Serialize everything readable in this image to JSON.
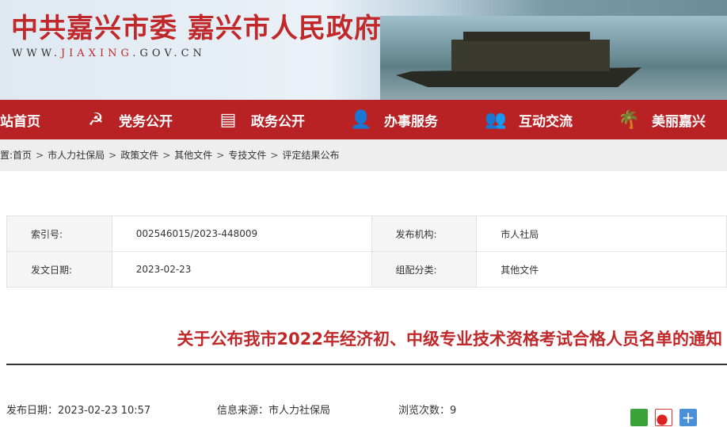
{
  "header": {
    "title": "中共嘉兴市委 嘉兴市人民政府",
    "url_prefix": "WWW.",
    "url_domain": "JIAXING",
    "url_suffix": ".GOV.CN"
  },
  "nav": [
    {
      "label": "站首页",
      "icon": "home-icon"
    },
    {
      "label": "党务公开",
      "icon": "party-book-icon"
    },
    {
      "label": "政务公开",
      "icon": "government-board-icon"
    },
    {
      "label": "办事服务",
      "icon": "service-person-icon"
    },
    {
      "label": "互动交流",
      "icon": "people-group-icon"
    },
    {
      "label": "美丽嘉兴",
      "icon": "palm-tree-icon"
    }
  ],
  "breadcrumb": {
    "prefix": "置:",
    "items": [
      "首页",
      "市人力社保局",
      "政策文件",
      "其他文件",
      "专技文件",
      "评定结果公布"
    ],
    "sep": ">"
  },
  "meta": {
    "index_label": "索引号:",
    "index_value": "002546015/2023-448009",
    "org_label": "发布机构:",
    "org_value": "市人社局",
    "date_label": "发文日期:",
    "date_value": "2023-02-23",
    "cat_label": "组配分类:",
    "cat_value": "其他文件"
  },
  "article": {
    "title": "关于公布我市2022年经济初、中级专业技术资格考试合格人员名单的通知",
    "publish": "发布日期：2023-02-23 10:57",
    "source": "信息来源：市人力社保局",
    "views": "浏览次数：9"
  },
  "colors": {
    "brand_red": "#b92224",
    "title_red": "#c0282a"
  }
}
